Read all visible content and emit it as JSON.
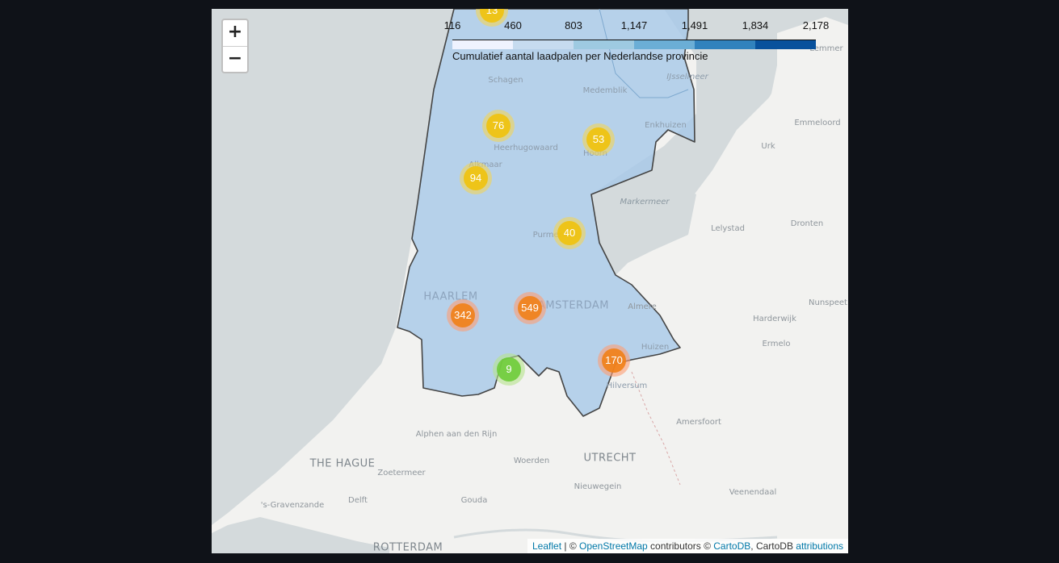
{
  "zoom": {
    "in_label": "+",
    "out_label": "−"
  },
  "legend": {
    "caption": "Cumulatief aantal laadpalen per Nederlandse provincie",
    "ticks": [
      "116",
      "460",
      "803",
      "1,147",
      "1,491",
      "1,834",
      "2,178"
    ],
    "colors": [
      "#eff3ff",
      "#c6dbef",
      "#9ecae1",
      "#6baed6",
      "#3182bd",
      "#08519c"
    ]
  },
  "region": {
    "fill": "#a6c8e8",
    "stroke": "#444444"
  },
  "clusters": [
    {
      "count": "13",
      "size": "medium"
    },
    {
      "count": "76",
      "size": "medium"
    },
    {
      "count": "53",
      "size": "medium"
    },
    {
      "count": "94",
      "size": "medium"
    },
    {
      "count": "40",
      "size": "medium"
    },
    {
      "count": "342",
      "size": "large"
    },
    {
      "count": "549",
      "size": "large"
    },
    {
      "count": "170",
      "size": "large"
    },
    {
      "count": "9",
      "size": "small"
    }
  ],
  "places": [
    {
      "name": "Lemmer"
    },
    {
      "name": "IJsselmeer"
    },
    {
      "name": "Schagen"
    },
    {
      "name": "Medemblik"
    },
    {
      "name": "Enkhuizen"
    },
    {
      "name": "Emmeloord"
    },
    {
      "name": "Heerhugowaard"
    },
    {
      "name": "Urk"
    },
    {
      "name": "Alkmaar"
    },
    {
      "name": "Hoorn"
    },
    {
      "name": "Markermeer"
    },
    {
      "name": "Purmerend"
    },
    {
      "name": "Lelystad"
    },
    {
      "name": "Dronten"
    },
    {
      "name": "HAARLEM"
    },
    {
      "name": "AMSTERDAM"
    },
    {
      "name": "Almere"
    },
    {
      "name": "Harderwijk"
    },
    {
      "name": "Nunspeet"
    },
    {
      "name": "Huizen"
    },
    {
      "name": "Ermelo"
    },
    {
      "name": "Hilversum"
    },
    {
      "name": "Amersfoort"
    },
    {
      "name": "Alphen aan den Rijn"
    },
    {
      "name": "THE HAGUE"
    },
    {
      "name": "Zoetermeer"
    },
    {
      "name": "Woerden"
    },
    {
      "name": "UTRECHT"
    },
    {
      "name": "Nieuwegein"
    },
    {
      "name": "Veenendaal"
    },
    {
      "name": "'s-Gravenzande"
    },
    {
      "name": "Delft"
    },
    {
      "name": "Gouda"
    },
    {
      "name": "ROTTERDAM"
    }
  ],
  "attribution": {
    "leaflet": "Leaflet",
    "sep1": " | © ",
    "osm": "OpenStreetMap",
    "mid": " contributors © ",
    "cartodb": "CartoDB",
    "mid2": ", CartoDB ",
    "attributions": "attributions"
  }
}
